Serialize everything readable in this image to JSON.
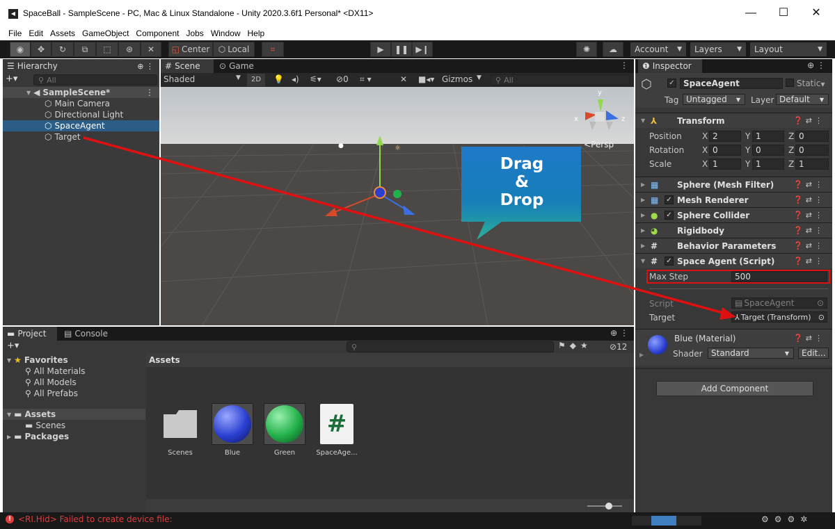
{
  "window": {
    "title": "SpaceBall - SampleScene - PC, Mac & Linux Standalone - Unity 2020.3.6f1 Personal* <DX11>",
    "minimize": "—",
    "maximize": "☐",
    "close": "✕"
  },
  "menu": [
    "File",
    "Edit",
    "Assets",
    "GameObject",
    "Component",
    "Jobs",
    "Window",
    "Help"
  ],
  "toolbar": {
    "center": "Center",
    "local": "Local",
    "account": "Account",
    "layers": "Layers",
    "layout": "Layout"
  },
  "hierarchy": {
    "tab": "Hierarchy",
    "search_placeholder": "All",
    "scene": "SampleScene*",
    "items": [
      "Main Camera",
      "Directional Light",
      "SpaceAgent",
      "Target"
    ],
    "selected": "SpaceAgent"
  },
  "scene": {
    "tab_scene": "Scene",
    "tab_game": "Game",
    "shading": "Shaded",
    "mode2d": "2D",
    "hidden_count": "0",
    "gizmos": "Gizmos",
    "search_placeholder": "All",
    "persp": "Persp",
    "axis_x": "x",
    "axis_y": "y",
    "axis_z": "z"
  },
  "callout": {
    "line1": "Drag",
    "line2": "&",
    "line3": "Drop"
  },
  "inspector": {
    "tab": "Inspector",
    "object_name": "SpaceAgent",
    "static_label": "Static",
    "tag_label": "Tag",
    "tag": "Untagged",
    "layer_label": "Layer",
    "layer": "Default",
    "transform": {
      "name": "Transform",
      "position_label": "Position",
      "rotation_label": "Rotation",
      "scale_label": "Scale",
      "position": {
        "x": "2",
        "y": "1",
        "z": "0"
      },
      "rotation": {
        "x": "0",
        "y": "0",
        "z": "0"
      },
      "scale": {
        "x": "1",
        "y": "1",
        "z": "1"
      }
    },
    "components": [
      "Sphere (Mesh Filter)",
      "Mesh Renderer",
      "Sphere Collider",
      "Rigidbody",
      "Behavior Parameters",
      "Space Agent (Script)"
    ],
    "script": {
      "max_step_label": "Max Step",
      "max_step": "500",
      "script_label": "Script",
      "script_value": "SpaceAgent",
      "target_label": "Target",
      "target_value": "Target (Transform)"
    },
    "material": {
      "name": "Blue (Material)",
      "shader_label": "Shader",
      "shader": "Standard",
      "edit": "Edit..."
    },
    "add_component": "Add Component"
  },
  "project": {
    "tab_project": "Project",
    "tab_console": "Console",
    "hidden_count": "12",
    "favorites": "Favorites",
    "fav_items": [
      "All Materials",
      "All Models",
      "All Prefabs"
    ],
    "assets_root": "Assets",
    "asset_folders": [
      "Scenes"
    ],
    "packages": "Packages",
    "assets_header": "Assets",
    "assets": [
      {
        "name": "Scenes",
        "type": "folder"
      },
      {
        "name": "Blue",
        "type": "material",
        "color": "#2a3fd0"
      },
      {
        "name": "Green",
        "type": "material",
        "color": "#22b04a"
      },
      {
        "name": "SpaceAge...",
        "type": "script"
      }
    ]
  },
  "status": {
    "message": "<RI.Hid> Failed to create device file:"
  }
}
